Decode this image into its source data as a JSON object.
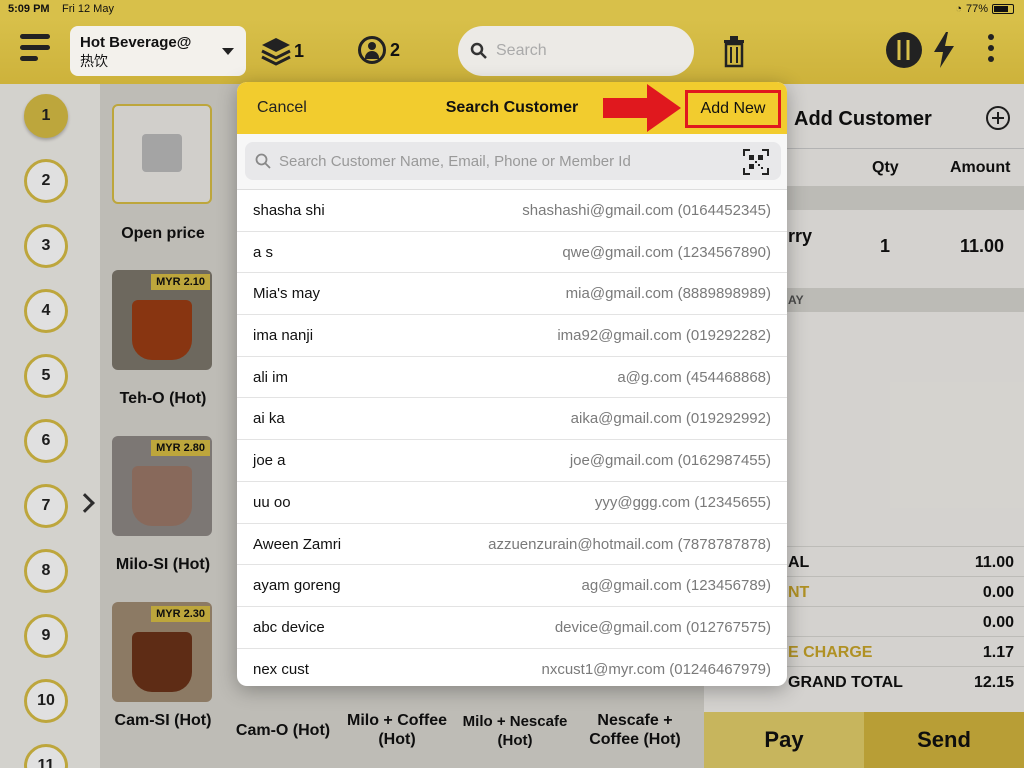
{
  "status": {
    "time": "5:09 PM",
    "date": "Fri 12 May",
    "battery": "77%",
    "battery_level": 0.77
  },
  "topbar": {
    "category_line1": "Hot Beverage@",
    "category_line2": "热饮",
    "layers_count": "1",
    "people_count": "2",
    "search_placeholder": "Search"
  },
  "tables": [
    "1",
    "2",
    "3",
    "4",
    "5",
    "6",
    "7",
    "8",
    "9",
    "10",
    "11"
  ],
  "products": [
    {
      "label": "Open price",
      "price": ""
    },
    {
      "label": "Teh-O (Hot)",
      "price": "MYR 2.10"
    },
    {
      "label": "Milo-SI (Hot)",
      "price": "MYR 2.80"
    },
    {
      "label": "Cam-SI (Hot)",
      "price": "MYR 2.30"
    },
    {
      "label": "Cam-O (Hot)",
      "price": ""
    },
    {
      "label": "Milo + Coffee (Hot)",
      "price": ""
    },
    {
      "label": "Milo + Nescafe (Hot)",
      "price": ""
    },
    {
      "label": "Nescafe + Coffee (Hot)",
      "price": ""
    }
  ],
  "order": {
    "header_title": "Add Customer",
    "col_qty": "Qty",
    "col_amount": "Amount",
    "item_name": "rry",
    "item_qty": "1",
    "item_amount": "11.00",
    "band2": "AY",
    "summary": [
      {
        "label": "AL",
        "value": "11.00",
        "gold": false
      },
      {
        "label": "NT",
        "value": "0.00",
        "gold": true
      },
      {
        "label": "",
        "value": "0.00",
        "gold": false
      },
      {
        "label": "E CHARGE",
        "value": "1.17",
        "gold": true
      },
      {
        "label": "GRAND TOTAL",
        "value": "12.15",
        "gold": false
      }
    ],
    "pay_label": "Pay",
    "send_label": "Send"
  },
  "modal": {
    "cancel_label": "Cancel",
    "title": "Search Customer",
    "add_new_label": "Add New",
    "search_placeholder": "Search Customer Name, Email, Phone or Member Id",
    "customers": [
      {
        "name": "shasha shi",
        "contact": "shashashi@gmail.com (0164452345)"
      },
      {
        "name": "a s",
        "contact": "qwe@gmail.com (1234567890)"
      },
      {
        "name": "Mia's may",
        "contact": "mia@gmail.com (8889898989)"
      },
      {
        "name": "ima nanji",
        "contact": "ima92@gmail.com (019292282)"
      },
      {
        "name": "ali im",
        "contact": "a@g.com (454468868)"
      },
      {
        "name": "ai ka",
        "contact": "aika@gmail.com (019292992)"
      },
      {
        "name": "joe a",
        "contact": "joe@gmail.com (0162987455)"
      },
      {
        "name": "uu oo",
        "contact": "yyy@ggg.com (12345655)"
      },
      {
        "name": "Aween Zamri",
        "contact": "azzuenzurain@hotmail.com (7878787878)"
      },
      {
        "name": "ayam goreng",
        "contact": "ag@gmail.com (123456789)"
      },
      {
        "name": "abc device",
        "contact": "device@gmail.com (012767575)"
      },
      {
        "name": "nex cust",
        "contact": "nxcust1@myr.com (01246467979)"
      }
    ]
  },
  "colors": {
    "accent": "#f2cc2e",
    "highlight": "#e0181e",
    "gold": "#d8bd45"
  }
}
